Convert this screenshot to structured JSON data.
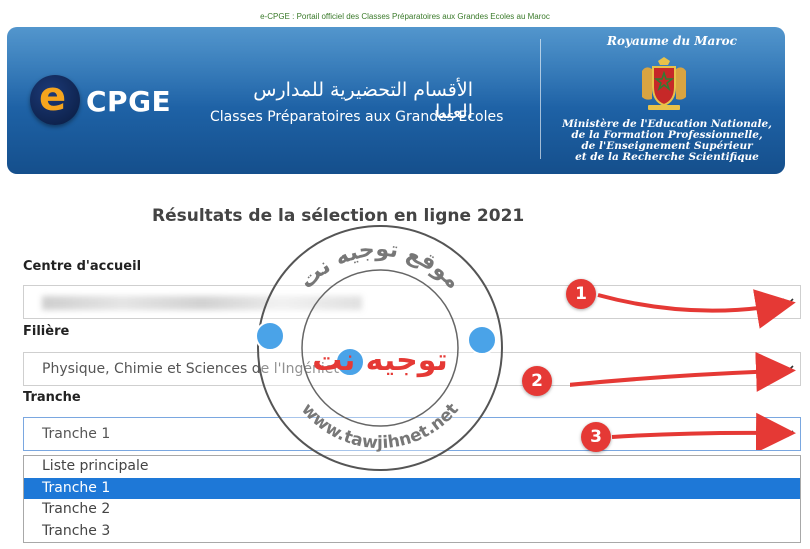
{
  "header": {
    "portal_line": "e-CPGE : Portail officiel des Classes Préparatoires aux Grandes Ecoles au Maroc",
    "logo_letter": "e",
    "logo_text": "CPGE",
    "arabic_title": "الأقسام التحضيرية للمدارس العليا",
    "french_title": "Classes Préparatoires aux Grandes Ecoles",
    "royaume": "Royaume du Maroc",
    "ministere_lines": [
      "Ministère de l'Education Nationale,",
      "de la Formation Professionnelle,",
      "de l'Enseignement Supérieur",
      "et de la Recherche Scientifique"
    ]
  },
  "page_title": "Résultats de la sélection en ligne 2021",
  "form": {
    "centre": {
      "label": "Centre d'accueil",
      "value_obscured": true
    },
    "filiere": {
      "label": "Filière",
      "value": "Physique, Chimie et Sciences de l'Ingénieur"
    },
    "tranche": {
      "label": "Tranche",
      "value": "Tranche 1",
      "options": [
        "Liste principale",
        "Tranche 1",
        "Tranche 2",
        "Tranche 3"
      ],
      "selected_index": 1
    }
  },
  "annotations": {
    "badges": [
      "1",
      "2",
      "3"
    ],
    "color": "#e53935"
  },
  "watermark": {
    "arabic_name": "توجيه نت",
    "arc_text_top": "موقع توجيه نت",
    "arc_text_bottom": "www.tawjihnet.net"
  },
  "colors": {
    "banner": "#1e62a6",
    "selected_option": "#1e78d7",
    "logo_e": "#f5a51e"
  }
}
